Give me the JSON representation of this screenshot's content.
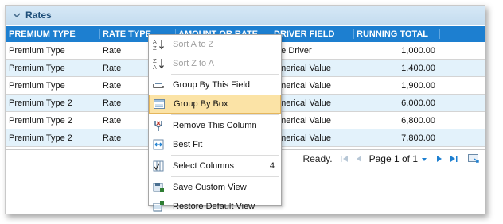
{
  "panel": {
    "title": "Rates"
  },
  "grid": {
    "columns": [
      "PREMIUM TYPE",
      "RATE TYPE",
      "AMOUNT OR RATE",
      "DRIVER FIELD",
      "RUNNING TOTAL"
    ],
    "rows": [
      [
        "Premium Type",
        "Rate",
        "",
        "ate Driver",
        "1,000.00"
      ],
      [
        "Premium Type",
        "Rate",
        "",
        "umerical Value",
        "1,400.00"
      ],
      [
        "Premium Type",
        "Rate",
        "",
        "umerical Value",
        "1,900.00"
      ],
      [
        "Premium Type 2",
        "Rate",
        "",
        "umerical Value",
        "6,000.00"
      ],
      [
        "Premium Type 2",
        "Rate",
        "",
        "umerical Value",
        "6,800.00"
      ],
      [
        "Premium Type 2",
        "Rate",
        "",
        "umerical Value",
        "7,800.00"
      ]
    ]
  },
  "footer": {
    "status": "Ready.",
    "page_text": "Page 1 of 1"
  },
  "context_menu": {
    "items": [
      {
        "label": "Sort A to Z",
        "icon": "sort-a-to-z-icon",
        "disabled": true
      },
      {
        "label": "Sort Z to A",
        "icon": "sort-z-to-a-icon",
        "disabled": true
      },
      {
        "label": "Group By This Field",
        "icon": "group-by-field-icon"
      },
      {
        "label": "Group By Box",
        "icon": "group-by-box-icon",
        "active": true
      },
      {
        "label": "Remove This Column",
        "icon": "remove-column-icon"
      },
      {
        "label": "Best Fit",
        "icon": "best-fit-icon"
      },
      {
        "label": "Select Columns",
        "icon": "select-columns-icon",
        "extra": "4"
      },
      {
        "label": "Save Custom View",
        "icon": "save-view-icon"
      },
      {
        "label": "Restore Default View",
        "icon": "restore-view-icon"
      }
    ]
  },
  "colors": {
    "header_blue": "#1d7fd0",
    "alt_row": "#e3f2fb",
    "highlight": "#fbe3a6"
  }
}
